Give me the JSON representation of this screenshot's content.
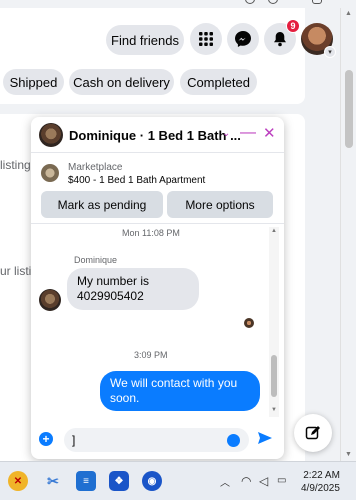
{
  "header": {
    "find_friends_label": "Find friends",
    "notification_count": "9"
  },
  "filters": [
    "Shipped",
    "Cash on delivery",
    "Completed"
  ],
  "background_text": {
    "line1": "listing:",
    "line2": "ur listi"
  },
  "chat": {
    "title": "Dominique · 1 Bed 1 Bath ...",
    "marketplace_label": "Marketplace",
    "listing": "$400 - 1 Bed 1 Bath Apartment",
    "mark_pending_label": "Mark as pending",
    "more_options_label": "More options",
    "timestamp1": "Mon 11:08 PM",
    "sender_name": "Dominique",
    "incoming_message": "My number is 4029905402",
    "timestamp2": "3:09 PM",
    "outgoing_message": "We will contact with you soon.",
    "composer_value": "]"
  },
  "taskbar": {
    "time": "2:22 AM",
    "date": "4/9/2025"
  },
  "colors": {
    "accent": "#0a7cff",
    "chat_controls": "#bc3fbf",
    "badge": "#e41e3f"
  }
}
